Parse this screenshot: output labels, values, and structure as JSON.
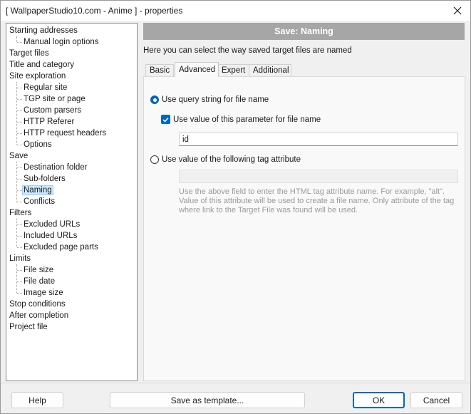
{
  "window": {
    "title": "[ WallpaperStudio10.com - Anime ] - properties"
  },
  "tree": {
    "items": [
      {
        "label": "Starting addresses",
        "level": 0
      },
      {
        "label": "Manual login options",
        "level": 1
      },
      {
        "label": "Target files",
        "level": 0
      },
      {
        "label": "Title and category",
        "level": 0
      },
      {
        "label": "Site exploration",
        "level": 0
      },
      {
        "label": "Regular site",
        "level": 1
      },
      {
        "label": "TGP site or page",
        "level": 1
      },
      {
        "label": "Custom parsers",
        "level": 1
      },
      {
        "label": "HTTP Referer",
        "level": 1
      },
      {
        "label": "HTTP request headers",
        "level": 1
      },
      {
        "label": "Options",
        "level": 1
      },
      {
        "label": "Save",
        "level": 0
      },
      {
        "label": "Destination folder",
        "level": 1
      },
      {
        "label": "Sub-folders",
        "level": 1
      },
      {
        "label": "Naming",
        "level": 1,
        "selected": true
      },
      {
        "label": "Conflicts",
        "level": 1
      },
      {
        "label": "Filters",
        "level": 0
      },
      {
        "label": "Excluded URLs",
        "level": 1
      },
      {
        "label": "Included URLs",
        "level": 1
      },
      {
        "label": "Excluded page parts",
        "level": 1
      },
      {
        "label": "Limits",
        "level": 0
      },
      {
        "label": "File size",
        "level": 1
      },
      {
        "label": "File date",
        "level": 1
      },
      {
        "label": "Image size",
        "level": 1
      },
      {
        "label": "Stop conditions",
        "level": 0
      },
      {
        "label": "After completion",
        "level": 0
      },
      {
        "label": "Project file",
        "level": 0
      }
    ]
  },
  "panel": {
    "header": "Save: Naming",
    "description": "Here you can select the way saved target files are named",
    "tabs": [
      "Basic",
      "Advanced",
      "Expert",
      "Additional"
    ],
    "active_tab": "Advanced",
    "query_string_option": "Use query string for file name",
    "query_string_selected": true,
    "param_checkbox_label": "Use value of this parameter for file name",
    "param_checkbox_checked": true,
    "param_value": "id",
    "tag_attribute_option": "Use value of the following tag attribute",
    "tag_attribute_value": "",
    "hint": "Use the above field to enter the HTML tag attribute name. For example, \"alt\". Value of this attribute will be used to create a file name. Only attribute of the tag where link to the Target File was found will be used."
  },
  "buttons": {
    "help": "Help",
    "save_template": "Save as template...",
    "ok": "OK",
    "cancel": "Cancel"
  },
  "colors": {
    "accent": "#0067c0",
    "header_bg": "#a6a6a6",
    "selection": "#cce8ff"
  },
  "icons": {
    "close": "close-icon",
    "checkmark": "checkmark-icon"
  }
}
